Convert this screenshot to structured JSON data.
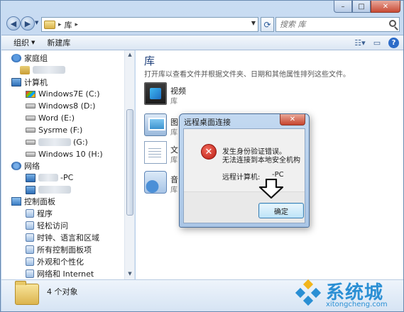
{
  "window": {
    "caption_buttons": {
      "minimize": "–",
      "maximize": "□",
      "close": "✕"
    }
  },
  "address": {
    "back_icon": "back-arrow",
    "forward_icon": "forward-arrow",
    "crumb": "库",
    "separator": "▸",
    "search_placeholder": "搜索 库"
  },
  "toolbar": {
    "organize": "组织",
    "new_library": "新建库"
  },
  "sidebar": {
    "homegroup": "家庭组",
    "computer": "计算机",
    "drives": [
      {
        "label": "Windows7E (C:)"
      },
      {
        "label": "Windows8 (D:)"
      },
      {
        "label": "Word (E:)"
      },
      {
        "label": "Sysrme (F:)"
      },
      {
        "label": "(G:)"
      },
      {
        "label": "Windows 10 (H:)"
      }
    ],
    "network": "网络",
    "network_pc": "-PC",
    "control_panel": "控制面板",
    "cp_items": [
      {
        "label": "程序"
      },
      {
        "label": "轻松访问"
      },
      {
        "label": "时钟、语言和区域"
      },
      {
        "label": "所有控制面板项"
      },
      {
        "label": "外观和个性化"
      },
      {
        "label": "网络和 Internet"
      }
    ]
  },
  "content": {
    "title": "库",
    "description": "打开库以查看文件并根据文件夹、日期和其他属性排列这些文件。",
    "libraries": [
      {
        "name": "视频",
        "sub": "库"
      },
      {
        "name": "图",
        "sub": "库"
      },
      {
        "name": "文",
        "sub": "库"
      },
      {
        "name": "音",
        "sub": "库"
      }
    ]
  },
  "status": {
    "count": "4 个对象"
  },
  "dialog": {
    "title": "远程桌面连接",
    "close": "✕",
    "message_line1": "发生身份验证错误。",
    "message_line2": "无法连接到本地安全机构",
    "remote_label": "远程计算机:",
    "remote_value": "-PC",
    "ok_label": "确定"
  },
  "watermark": {
    "brand": "系统城",
    "url": "xitongcheng.com"
  }
}
